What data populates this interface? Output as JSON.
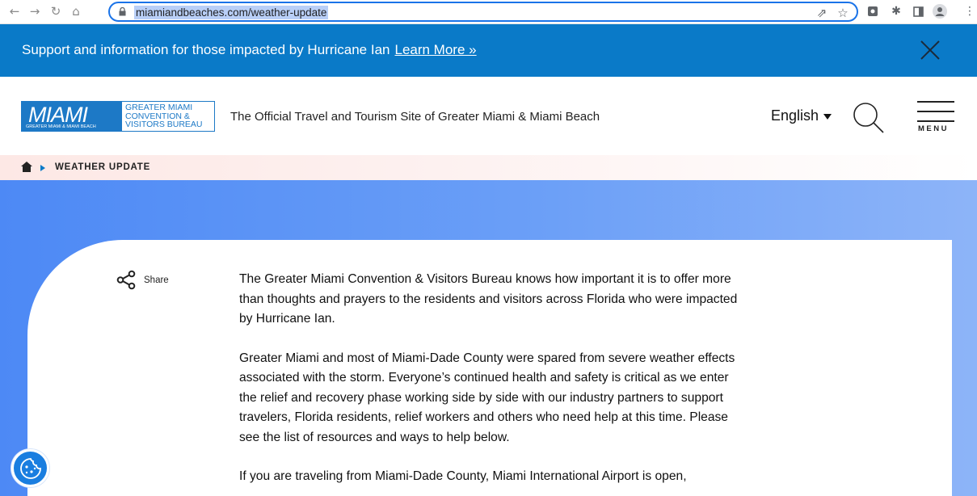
{
  "browser": {
    "url": "miamiandbeaches.com/weather-update"
  },
  "alert": {
    "message": "Support and information for those impacted by Hurricane Ian",
    "link_label": "Learn More »"
  },
  "header": {
    "logo_word": "MIAMI",
    "logo_subtext": "GREATER MIAMI & MIAMI BEACH",
    "logo_bureau": "GREATER MIAMI\nCONVENTION &\nVISITORS BUREAU",
    "tagline": "The Official Travel and Tourism Site of Greater Miami & Miami Beach",
    "language": "English",
    "menu_label": "MENU"
  },
  "breadcrumb": {
    "current": "WEATHER UPDATE"
  },
  "share": {
    "label": "Share"
  },
  "article": {
    "paragraphs": [
      "The Greater Miami Convention & Visitors Bureau knows how important it is to offer more than thoughts and prayers to the residents and visitors across Florida who were impacted by Hurricane Ian.",
      "Greater Miami and most of Miami-Dade County were spared from severe weather effects associated with the storm. Everyone’s continued health and safety is critical as we enter the relief and recovery phase working side by side with our industry partners to support travelers, Florida residents, relief workers and others who need help at this time. Please see the list of resources and ways to help below.",
      "If you are traveling from Miami-Dade County, Miami International Airport is open,"
    ]
  },
  "colors": {
    "banner": "#0a7ac8",
    "brand": "#1d79c6",
    "hero_start": "#4d89f5",
    "hero_end": "#8db4f8"
  }
}
